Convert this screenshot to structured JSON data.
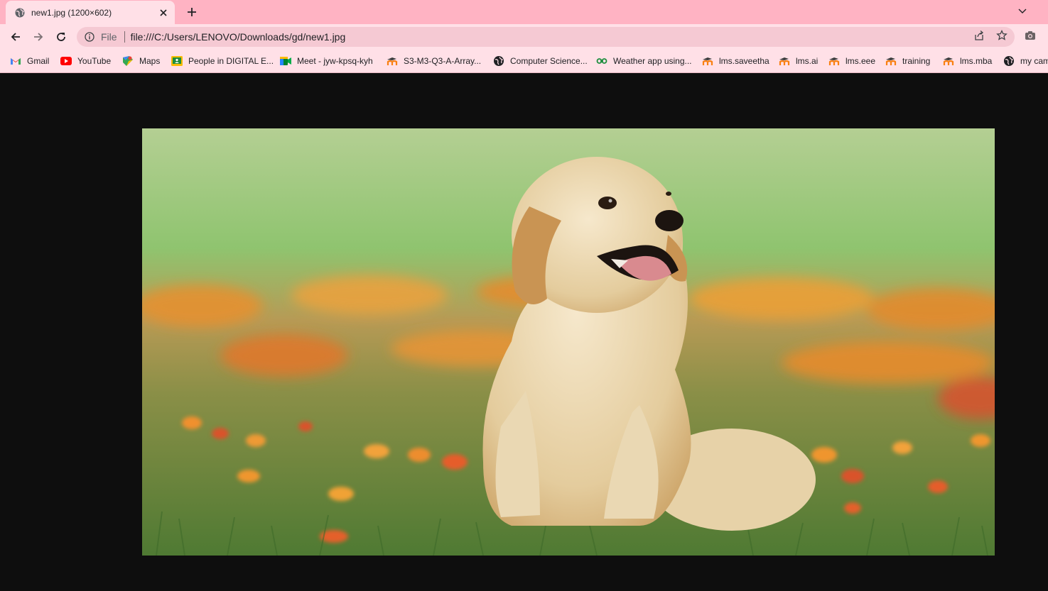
{
  "tab": {
    "title": "new1.jpg (1200×602)",
    "favicon": "globe-icon"
  },
  "toolbar": {
    "scheme_label": "File",
    "url": "file:///C:/Users/LENOVO/Downloads/gd/new1.jpg"
  },
  "bookmarks": [
    {
      "label": "Gmail",
      "icon": "gmail-icon"
    },
    {
      "label": "YouTube",
      "icon": "youtube-icon"
    },
    {
      "label": "Maps",
      "icon": "maps-icon"
    },
    {
      "label": "People in DIGITAL E...",
      "icon": "classroom-icon"
    },
    {
      "label": "Meet - jyw-kpsq-kyh",
      "icon": "meet-icon"
    },
    {
      "label": "S3-M3-Q3-A-Array...",
      "icon": "moodle-icon"
    },
    {
      "label": "Computer Science...",
      "icon": "globe-icon"
    },
    {
      "label": "Weather app using...",
      "icon": "link-icon"
    },
    {
      "label": "lms.saveetha",
      "icon": "moodle-icon"
    },
    {
      "label": "lms.ai",
      "icon": "moodle-icon"
    },
    {
      "label": "lms.eee",
      "icon": "moodle-icon"
    },
    {
      "label": "training",
      "icon": "moodle-icon"
    },
    {
      "label": "lms.mba",
      "icon": "moodle-icon"
    },
    {
      "label": "my cam",
      "icon": "globe-icon"
    }
  ],
  "colors": {
    "tabstrip": "#ffb3c3",
    "toolbar": "#ffe0e7",
    "omnibox": "#f5c9d3",
    "viewer_bg": "#0e0e0e"
  }
}
